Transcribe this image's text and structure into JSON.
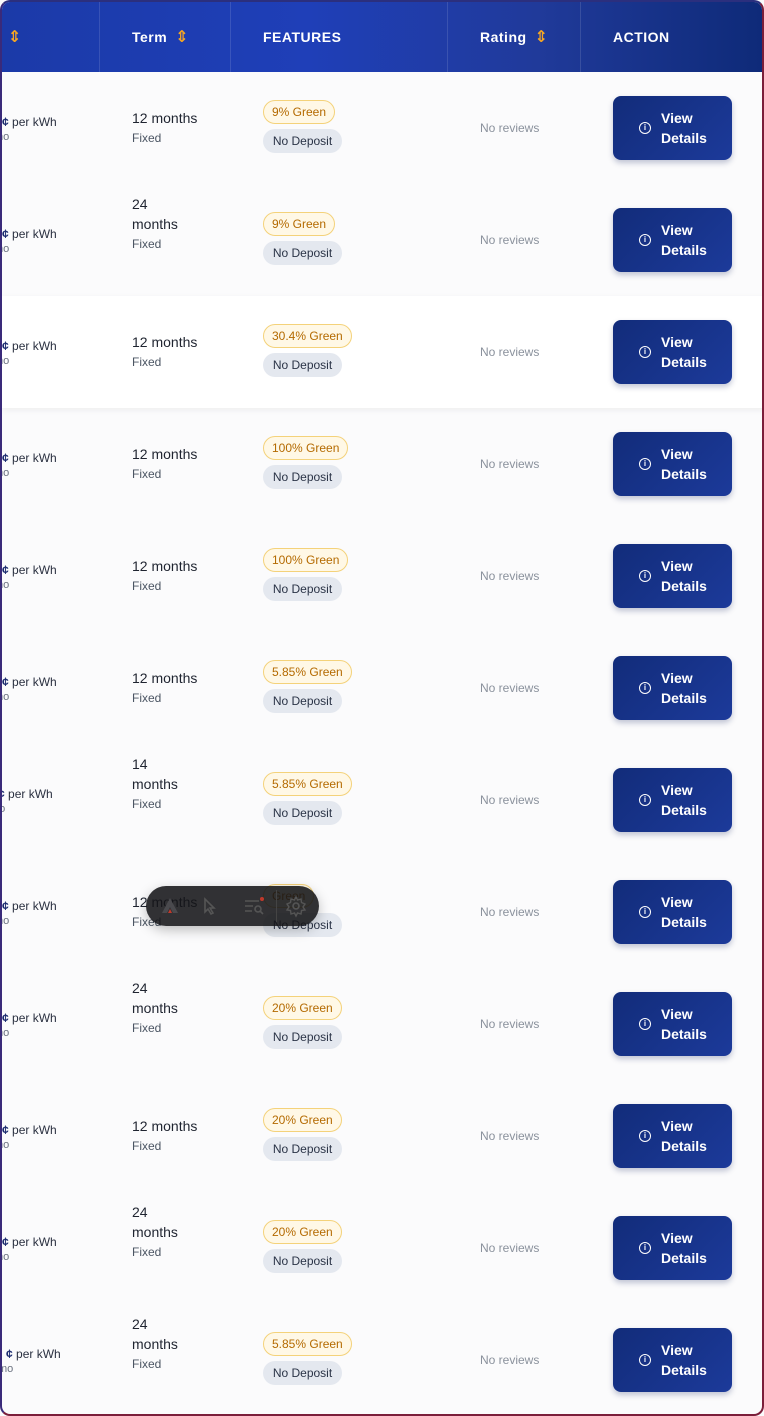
{
  "header": {
    "columns": [
      {
        "label": "",
        "sortable": true
      },
      {
        "label": "Term",
        "sortable": true
      },
      {
        "label": "FEATURES",
        "sortable": false
      },
      {
        "label": "Rating",
        "sortable": true
      },
      {
        "label": "ACTION",
        "sortable": false
      }
    ],
    "sort_icon": "⇕"
  },
  "colors": {
    "accent": "#1c3a9a",
    "sort": "#f5a623",
    "green_badge": "#b46a00"
  },
  "rows": [
    {
      "price_unit": "per kWh",
      "price_sub": "mo",
      "term": "12 months",
      "term_type": "Fixed",
      "green": "9% Green",
      "deposit": "No Deposit",
      "rating": "No reviews",
      "action": "View Details"
    },
    {
      "price_unit": "per kWh",
      "price_sub": "mo",
      "term": "24 months",
      "term_type": "Fixed",
      "green": "9% Green",
      "deposit": "No Deposit",
      "rating": "No reviews",
      "action": "View Details"
    },
    {
      "price_unit": "per kWh",
      "price_sub": "mo",
      "term": "12 months",
      "term_type": "Fixed",
      "green": "30.4% Green",
      "deposit": "No Deposit",
      "rating": "No reviews",
      "action": "View Details"
    },
    {
      "price_unit": "per kWh",
      "price_sub": "mo",
      "term": "12 months",
      "term_type": "Fixed",
      "green": "100% Green",
      "deposit": "No Deposit",
      "rating": "No reviews",
      "action": "View Details"
    },
    {
      "price_unit": "per kWh",
      "price_sub": "mo",
      "term": "12 months",
      "term_type": "Fixed",
      "green": "100% Green",
      "deposit": "No Deposit",
      "rating": "No reviews",
      "action": "View Details"
    },
    {
      "price_unit": "per kWh",
      "price_sub": "mo",
      "term": "12 months",
      "term_type": "Fixed",
      "green": "5.85% Green",
      "deposit": "No Deposit",
      "rating": "No reviews",
      "action": "View Details"
    },
    {
      "price_unit": "per kWh",
      "price_sub": "mo",
      "term": "14 months",
      "term_type": "Fixed",
      "green": "5.85% Green",
      "deposit": "No Deposit",
      "rating": "No reviews",
      "action": "View Details"
    },
    {
      "price_unit": "per kWh",
      "price_sub": "mo",
      "term": "12 months",
      "term_type": "Fixed",
      "green": "Green",
      "deposit": "No Deposit",
      "rating": "No reviews",
      "action": "View Details"
    },
    {
      "price_unit": "per kWh",
      "price_sub": "mo",
      "term": "24 months",
      "term_type": "Fixed",
      "green": "20% Green",
      "deposit": "No Deposit",
      "rating": "No reviews",
      "action": "View Details"
    },
    {
      "price_unit": "per kWh",
      "price_sub": "mo",
      "term": "12 months",
      "term_type": "Fixed",
      "green": "20% Green",
      "deposit": "No Deposit",
      "rating": "No reviews",
      "action": "View Details"
    },
    {
      "price_unit": "per kWh",
      "price_sub": "mo",
      "term": "24 months",
      "term_type": "Fixed",
      "green": "20% Green",
      "deposit": "No Deposit",
      "rating": "No reviews",
      "action": "View Details"
    },
    {
      "price_unit": "per kWh",
      "price_sub": "mo",
      "term": "24 months",
      "term_type": "Fixed",
      "green": "5.85% Green",
      "deposit": "No Deposit",
      "rating": "No reviews",
      "action": "View Details"
    }
  ],
  "toolbar": {
    "icons": [
      "logo-icon",
      "cursor-select-icon",
      "inspect-list-icon",
      "settings-gear-icon"
    ]
  }
}
